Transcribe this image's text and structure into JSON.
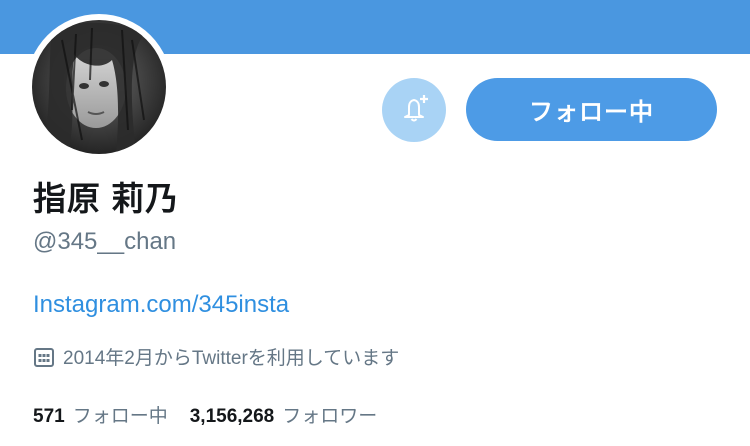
{
  "header": {
    "banner_color": "#4a97e0"
  },
  "profile": {
    "avatar_icon": "profile-photo",
    "display_name": "指原 莉乃",
    "handle": "@345__chan",
    "link": "Instagram.com/345insta",
    "joined_icon": "calendar-icon",
    "joined": "2014年2月からTwitterを利用しています"
  },
  "actions": {
    "notify_icon": "bell-plus-icon",
    "follow_label": "フォロー中",
    "follow_color": "#4d9be6"
  },
  "stats": {
    "following_count": "571",
    "following_label": "フォロー中",
    "followers_count": "3,156,268",
    "followers_label": "フォロワー"
  }
}
